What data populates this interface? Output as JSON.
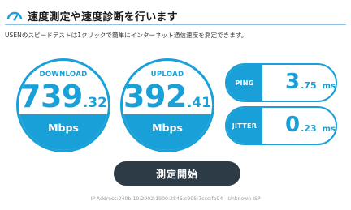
{
  "header": {
    "title": "速度測定や速度診断を行います",
    "icon": "speedometer-icon"
  },
  "description": "USENのスピードテストは1クリックで簡単にインターネット通信速度を測定できます。",
  "download": {
    "label": "DOWNLOAD",
    "int": "739",
    "dec": ".32",
    "unit": "Mbps"
  },
  "upload": {
    "label": "UPLOAD",
    "int": "392",
    "dec": ".41",
    "unit": "Mbps"
  },
  "ping": {
    "label": "PING",
    "int": "3",
    "dec": ".75",
    "unit": "ms"
  },
  "jitter": {
    "label": "JITTER",
    "int": "0",
    "dec": ".23",
    "unit": "ms"
  },
  "start_button": "測定開始",
  "ip_info": "IP Address:240b:10:2902:1900:2845:c905:7ccc:fa94 - Unknown ISP",
  "colors": {
    "accent": "#1aa0d8",
    "button": "#2d3b47"
  }
}
